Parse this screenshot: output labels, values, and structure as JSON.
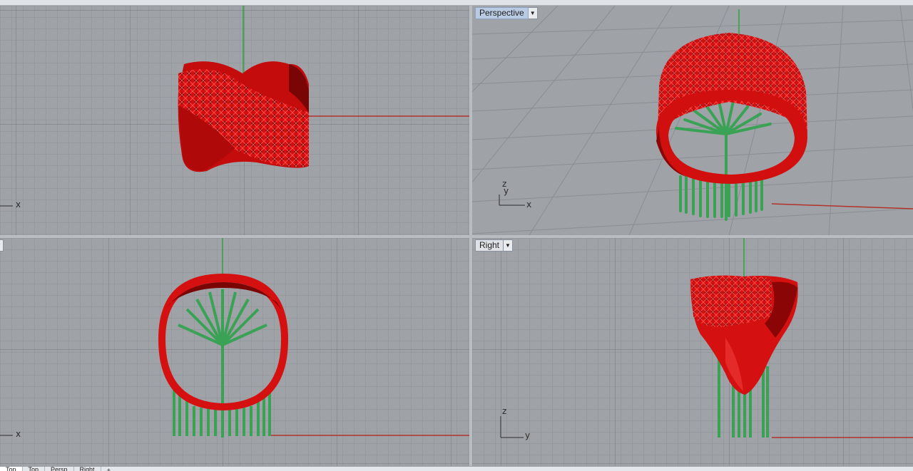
{
  "viewports": {
    "top": {
      "axis_x": "x"
    },
    "perspective": {
      "label": "Perspective",
      "axis_z": "z",
      "axis_y": "y",
      "axis_x": "x"
    },
    "front": {
      "axis_x": "x"
    },
    "right": {
      "label": "Right",
      "axis_z": "z",
      "axis_y": "y"
    }
  },
  "tabs": [
    {
      "label": "Top"
    },
    {
      "label": "Top"
    },
    {
      "label": "Persp"
    },
    {
      "label": "Right"
    }
  ],
  "tab_add": "+",
  "colors": {
    "viewport_bg": "#9fa3a8",
    "grid_minor": "#8d9196",
    "grid_major": "#7b7f84",
    "model_red": "#d41010",
    "support_green": "#3aa255",
    "axis_x_red": "#b0322c",
    "axis_y_green": "#2fa33c",
    "active_label": "#b9cbe2"
  },
  "icons": [
    "viewport-menu-arrow-icon",
    "axis-widget-icon"
  ]
}
